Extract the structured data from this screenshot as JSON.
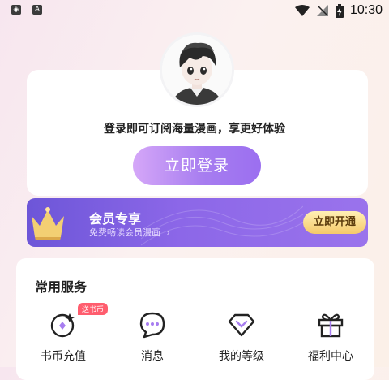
{
  "status_bar": {
    "time": "10:30",
    "left_icon_2": "A"
  },
  "login": {
    "tip": "登录即可订阅海量漫画，享更好体验",
    "button_label": "立即登录"
  },
  "vip": {
    "title": "会员专享",
    "subtitle": "免费畅读会员漫画",
    "button_label": "立即开通"
  },
  "services": {
    "title": "常用服务",
    "items": [
      {
        "label": "书币充值",
        "icon": "coin-icon",
        "badge": "送书币"
      },
      {
        "label": "消息",
        "icon": "message-icon"
      },
      {
        "label": "我的等级",
        "icon": "diamond-icon"
      },
      {
        "label": "福利中心",
        "icon": "gift-icon"
      }
    ]
  }
}
